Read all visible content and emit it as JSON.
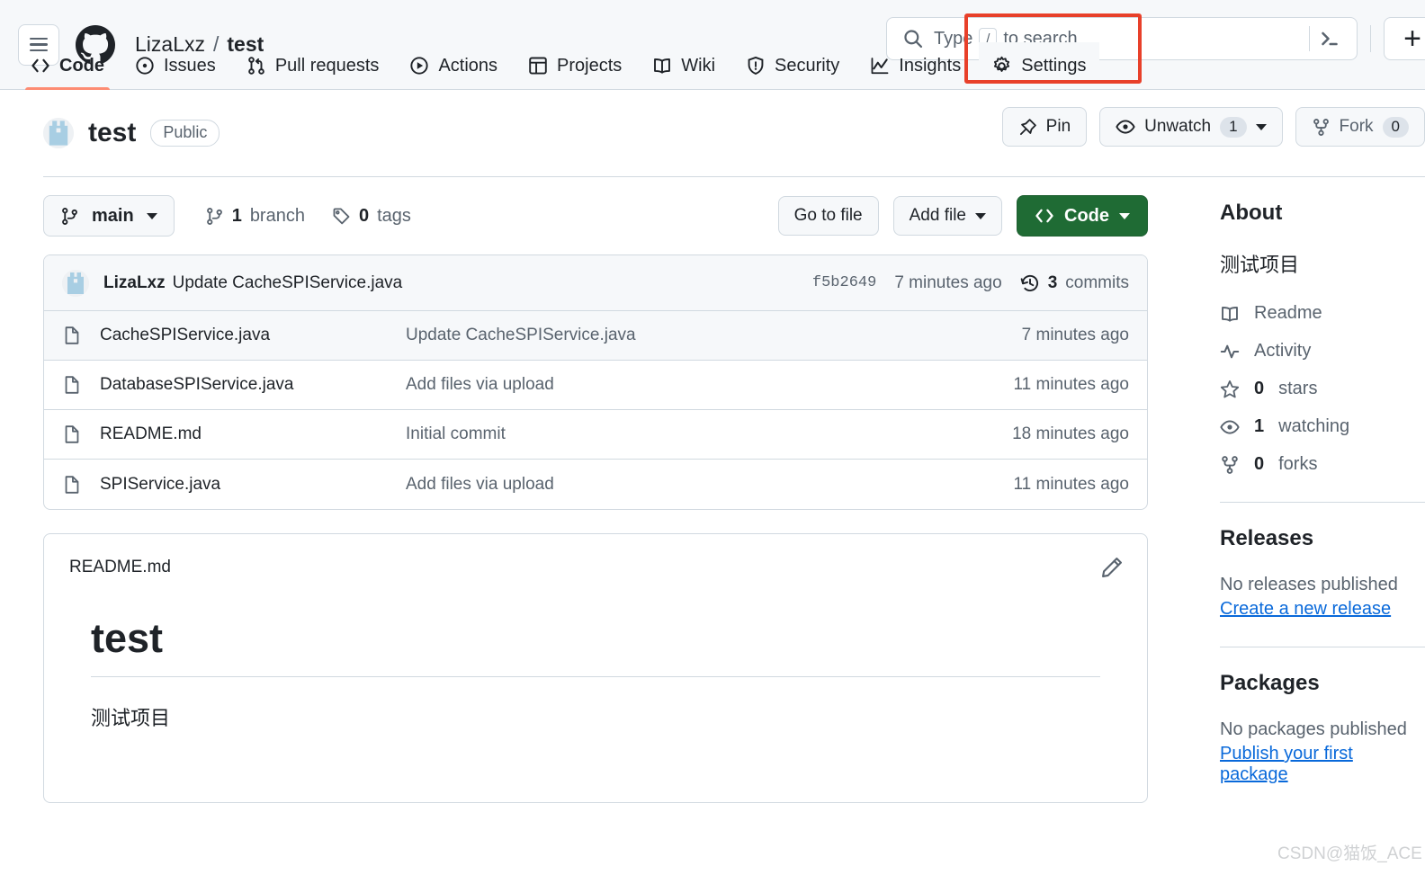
{
  "header": {
    "menu_icon": "hamburger-icon",
    "logo_icon": "github-logo-icon",
    "owner": "LizaLxz",
    "separator": "/",
    "repo": "test",
    "search": {
      "icon": "search-icon",
      "placeholder_prefix": "Type",
      "slash_key": "/",
      "placeholder_suffix": "to search",
      "command_icon": "terminal-icon"
    },
    "create_new": "+"
  },
  "repo_nav": {
    "tabs": [
      {
        "label": "Code",
        "icon": "code-icon",
        "active": true
      },
      {
        "label": "Issues",
        "icon": "issue-opened-icon",
        "active": false
      },
      {
        "label": "Pull requests",
        "icon": "git-pull-request-icon",
        "active": false
      },
      {
        "label": "Actions",
        "icon": "play-icon",
        "active": false
      },
      {
        "label": "Projects",
        "icon": "table-icon",
        "active": false
      },
      {
        "label": "Wiki",
        "icon": "book-icon",
        "active": false
      },
      {
        "label": "Security",
        "icon": "shield-icon",
        "active": false
      },
      {
        "label": "Insights",
        "icon": "graph-icon",
        "active": false
      },
      {
        "label": "Settings",
        "icon": "gear-icon",
        "active": false,
        "highlighted": true
      }
    ],
    "highlight_color": "#e8402a",
    "active_underline_color": "#fd8c73"
  },
  "repo_header": {
    "avatar": "repo-owner-avatar",
    "name": "test",
    "visibility": "Public",
    "actions": {
      "pin": {
        "label": "Pin",
        "icon": "pin-icon"
      },
      "watch": {
        "label": "Unwatch",
        "icon": "eye-icon",
        "count": "1"
      },
      "fork": {
        "label": "Fork",
        "icon": "repo-forked-icon",
        "count": "0"
      }
    }
  },
  "branch_bar": {
    "branch": "main",
    "branch_icon": "git-branch-icon",
    "branches": {
      "count": "1",
      "label": "branch",
      "icon": "git-branch-icon"
    },
    "tags": {
      "count": "0",
      "label": "tags",
      "icon": "tag-icon"
    },
    "go_to_file": "Go to file",
    "add_file": "Add file",
    "code_button": "Code",
    "code_icon": "code-icon"
  },
  "commit_bar": {
    "author": "LizaLxz",
    "message": "Update CacheSPIService.java",
    "sha": "f5b2649",
    "time": "7 minutes ago",
    "commits_count": "3",
    "commits_label": "commits",
    "history_icon": "history-icon"
  },
  "files": [
    {
      "name": "CacheSPIService.java",
      "message": "Update CacheSPIService.java",
      "time": "7 minutes ago",
      "icon": "file-icon",
      "highlighted": true
    },
    {
      "name": "DatabaseSPIService.java",
      "message": "Add files via upload",
      "time": "11 minutes ago",
      "icon": "file-icon",
      "highlighted": false
    },
    {
      "name": "README.md",
      "message": "Initial commit",
      "time": "18 minutes ago",
      "icon": "file-icon",
      "highlighted": false
    },
    {
      "name": "SPIService.java",
      "message": "Add files via upload",
      "time": "11 minutes ago",
      "icon": "file-icon",
      "highlighted": false
    }
  ],
  "readme": {
    "filename": "README.md",
    "edit_icon": "pencil-icon",
    "heading": "test",
    "body": "测试项目"
  },
  "sidebar": {
    "about": {
      "title": "About",
      "description": "测试项目",
      "links": [
        {
          "label": "Readme",
          "icon": "book-icon",
          "count": ""
        },
        {
          "label": "Activity",
          "icon": "pulse-icon",
          "count": ""
        },
        {
          "label": "stars",
          "icon": "star-icon",
          "count": "0"
        },
        {
          "label": "watching",
          "icon": "eye-icon",
          "count": "1"
        },
        {
          "label": "forks",
          "icon": "repo-forked-icon",
          "count": "0"
        }
      ]
    },
    "releases": {
      "title": "Releases",
      "empty": "No releases published",
      "action": "Create a new release"
    },
    "packages": {
      "title": "Packages",
      "empty": "No packages published",
      "action": "Publish your first package"
    }
  },
  "watermark": "CSDN@猫饭_ACE"
}
